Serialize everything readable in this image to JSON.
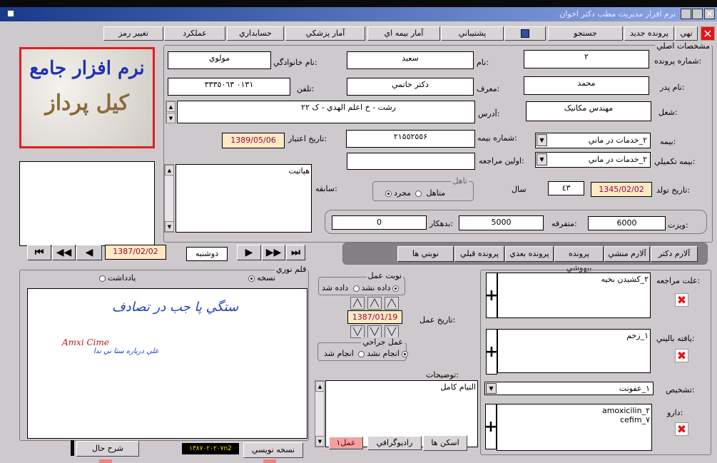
{
  "window": {
    "title": "نرم افزار مديريت مطب دکتر اخوان"
  },
  "toolbar": {
    "labels": [
      "تهي",
      "پرونده جديد",
      "جستجو",
      "",
      "پشتيباني",
      "آمار بيمه اي",
      "آمار پزشکي",
      "حسابداري",
      "عملکرد",
      "تغيير رمز"
    ]
  },
  "section_title": "مشخصات اصلي",
  "logo": {
    "line1": "نرم افزار جامع",
    "line2": "کيل پرداز"
  },
  "patient": {
    "file_no_label": "شماره پرونده:",
    "file_no": "٢",
    "first_name_label": "نام:",
    "first_name": "سعيد",
    "family_label": "نام خانوادگي:",
    "family": "مولوي",
    "father_label": "نام پدر:",
    "father": "محمد",
    "referrer_label": "معرف:",
    "referrer": "دکتر خاتمي",
    "phone_label": "تلفن:",
    "phone": "٠١٣١  ٣٣٣٥٠٦٣",
    "job_label": "شغل:",
    "job": "مهندس مکانيک",
    "address_label": "آدرس:",
    "address": "رشت - خ اعلم الهدي - ک ٢٢",
    "insurance_label": "بيمه:",
    "insurance": "٢_خدمات در ماني",
    "insurance_no_label": "شماره بيمه:",
    "insurance_no": "٢١٥٥٢٥٥۶",
    "validity_label": "تاريخ اعتبار:",
    "validity": "1389/05/06",
    "supp_label": "بيمه تکميلي:",
    "supp": "٢_خدمات در ماني",
    "first_visit_label": "اولين مراجعه:",
    "first_visit": "",
    "history_label": "سابقه:",
    "history": "هپاتيت",
    "marital_group": "تاهل",
    "single": "مجرد",
    "married": "متاهل",
    "birth_label": "تاريخ تولد:",
    "birth": "1345/02/02",
    "age": "٤٣",
    "age_label": "سال",
    "visit_label": "ويزت:",
    "visit": "6000",
    "misc_label": "متفرقه:",
    "misc": "5000",
    "debt_label": "بدهکار:",
    "debt": "0"
  },
  "nav": {
    "date": "1387/02/02",
    "day": "دوشنبه"
  },
  "tabs": [
    "آلارم دکتر",
    "آلارم منشي",
    "پرونده بيهوشي",
    "پرونده بعدي",
    "پرونده قبلي",
    "نوبتي ها"
  ],
  "pen": {
    "group": "قلم نوري",
    "note": "يادداشت",
    "prescription": "نسخه",
    "handwriting1": "ستگي پا جب در تصادف",
    "handwriting2": "Amxi Cime",
    "handwriting3": "علي درباره ستا ني ندا",
    "rx_button": "نسخه نويسي",
    "code": "١٣٨٧٠٢٠٢٠٧n2",
    "history_button": "شرح حال"
  },
  "op": {
    "turn_group": "نوبت عمل",
    "given": "داده شد",
    "not_given": "داده نشد",
    "date_label": "تاريخ عمل:",
    "date": "1387/01/19",
    "surgery_group": "عمل جراحي",
    "done": "انجام شد",
    "not_done": "انجام نشد",
    "desc_label": "توضيحات:",
    "desc": "التيام کامل",
    "scan": "اسکن ها",
    "radio": "راديوگرافي",
    "op_btn": "عمل١"
  },
  "clinic": {
    "reason_label": "علت مراجعه:",
    "reason": "٢_کشيدن بخيه",
    "finding_label": "يافته باليني:",
    "finding": "١_زخم",
    "diagnosis_label": "تشخيص:",
    "diagnosis": "١_عفونت",
    "drug_label": "دارو:",
    "drugs": "amoxicilin_٢\ncefim_٧"
  }
}
